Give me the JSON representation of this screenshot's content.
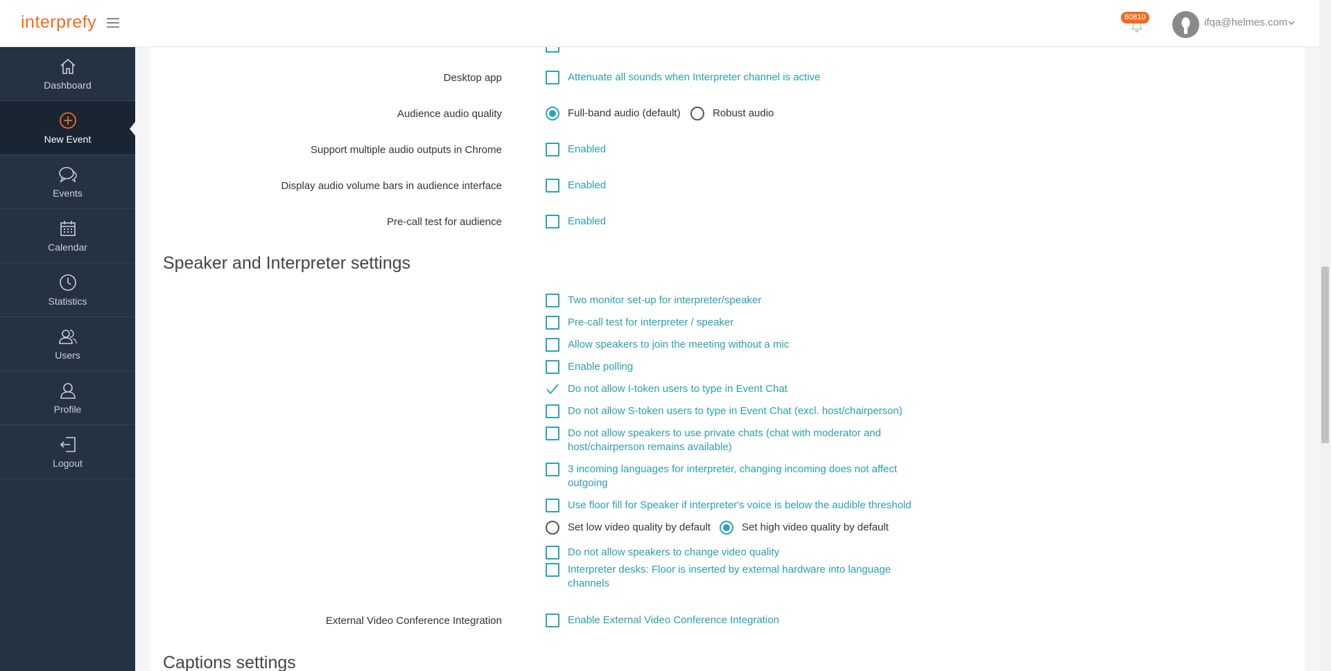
{
  "header": {
    "logo": "interprefy",
    "notification_count": "80810",
    "user_email": "ifqa@helmes.com"
  },
  "sidebar": {
    "items": [
      {
        "label": "Dashboard",
        "icon": "home-icon"
      },
      {
        "label": "New Event",
        "icon": "plus-circle-icon"
      },
      {
        "label": "Events",
        "icon": "chat-icon"
      },
      {
        "label": "Calendar",
        "icon": "calendar-icon"
      },
      {
        "label": "Statistics",
        "icon": "clock-icon"
      },
      {
        "label": "Users",
        "icon": "users-icon"
      },
      {
        "label": "Profile",
        "icon": "user-icon"
      },
      {
        "label": "Logout",
        "icon": "logout-icon"
      }
    ]
  },
  "audience": {
    "desktop_app_label": "Desktop app",
    "desktop_app_option": "Attenuate all sounds when Interpreter channel is active",
    "audio_quality_label": "Audience audio quality",
    "audio_quality_options": [
      "Full-band audio (default)",
      "Robust audio"
    ],
    "multi_output_label": "Support multiple audio outputs in Chrome",
    "multi_output_option": "Enabled",
    "volume_bars_label": "Display audio volume bars in audience interface",
    "volume_bars_option": "Enabled",
    "precall_label": "Pre-call test for audience",
    "precall_option": "Enabled"
  },
  "speaker_section": {
    "title": "Speaker and Interpreter settings",
    "options": [
      "Two monitor set-up for interpreter/speaker",
      "Pre-call test for interpreter / speaker",
      "Allow speakers to join the meeting without a mic",
      "Enable polling",
      "Do not allow I-token users to type in Event Chat",
      "Do not allow S-token users to type in Event Chat (excl. host/chairperson)",
      "Do not allow speakers to use private chats (chat with moderator and host/chairperson remains available)",
      "3 incoming languages for interpreter, changing incoming does not affect outgoing",
      "Use floor fill for Speaker if interpreter's voice is below the audible threshold"
    ],
    "video_quality_options": [
      "Set low video quality by default",
      "Set high video quality by default"
    ],
    "options_after": [
      "Do not allow speakers to change video quality",
      "Interpreter desks: Floor is inserted by external hardware into language channels"
    ],
    "external_label": "External Video Conference Integration",
    "external_option": "Enable External Video Conference Integration"
  },
  "captions_section": {
    "title": "Captions settings"
  },
  "colors": {
    "accent": "#2aa5b4",
    "brand": "#f26b21",
    "sidebar": "#243244"
  }
}
